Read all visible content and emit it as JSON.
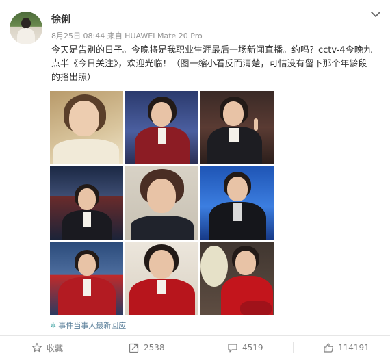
{
  "post": {
    "username": "徐俐",
    "meta": "8月25日 08:44 来自 HUAWEI Mate 20 Pro",
    "text": "今天是告别的日子。今晚将是我职业生涯最后一场新闻直播。约吗？cctv-4今晚九点半《今日关注》，欢迎光临！（图一缩小看反而清楚，可惜没有留下那个年龄段的播出照）",
    "photo_count": 9,
    "reply_link": "事件当事人最新回应",
    "reply_icon": "gear-flower-icon"
  },
  "actions": {
    "favorite_label": "收藏",
    "repost_count": "2538",
    "comment_count": "4519",
    "like_count": "114191"
  },
  "colors": {
    "link": "#5a7f9a",
    "meta": "#939393",
    "action": "#808080"
  }
}
